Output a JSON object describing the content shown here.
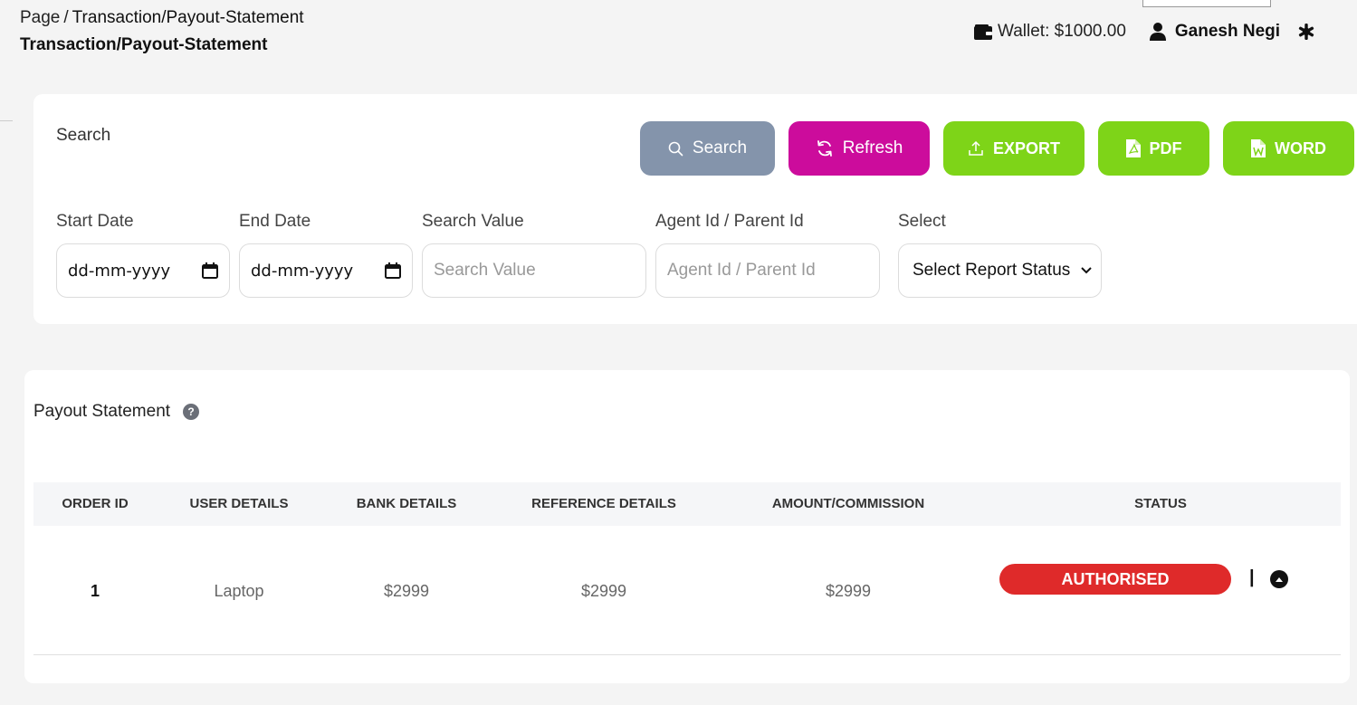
{
  "breadcrumb": {
    "root": "Page",
    "separator": "/",
    "current": "Transaction/Payout-Statement"
  },
  "page_title": "Transaction/Payout-Statement",
  "header": {
    "wallet_label": "Wallet: $1000.00",
    "user_name": "Ganesh Negi",
    "icons": [
      "wallet-icon",
      "user-icon",
      "gear-icon"
    ]
  },
  "search_panel": {
    "label": "Search",
    "buttons": {
      "search": "Search",
      "refresh": "Refresh",
      "export": "EXPORT",
      "pdf": "PDF",
      "word": "WORD"
    },
    "fields": {
      "start_date": {
        "label": "Start Date",
        "value": "dd-mm-yyyy"
      },
      "end_date": {
        "label": "End Date",
        "value": "dd-mm-yyyy"
      },
      "search_value": {
        "label": "Search Value",
        "placeholder": "Search Value"
      },
      "agent_id": {
        "label": "Agent Id / Parent Id",
        "placeholder": "Agent Id / Parent Id"
      },
      "report_status": {
        "label": "Select",
        "selected": "Select Report Status"
      }
    }
  },
  "table": {
    "title": "Payout Statement",
    "help": "?",
    "columns": [
      "ORDER ID",
      "USER DETAILS",
      "BANK DETAILS",
      "REFERENCE DETAILS",
      "AMOUNT/COMMISSION",
      "STATUS"
    ],
    "rows": [
      {
        "order_id": "1",
        "user_details": "Laptop",
        "bank_details": "$2999",
        "reference_details": "$2999",
        "amount_commission": "$2999",
        "status": "AUTHORISED",
        "separator": "|"
      }
    ]
  },
  "colors": {
    "search_button": "#8494ab",
    "refresh_button": "#cc0c9c",
    "export_button": "#7ed418",
    "status_authorised": "#df2a2a"
  }
}
